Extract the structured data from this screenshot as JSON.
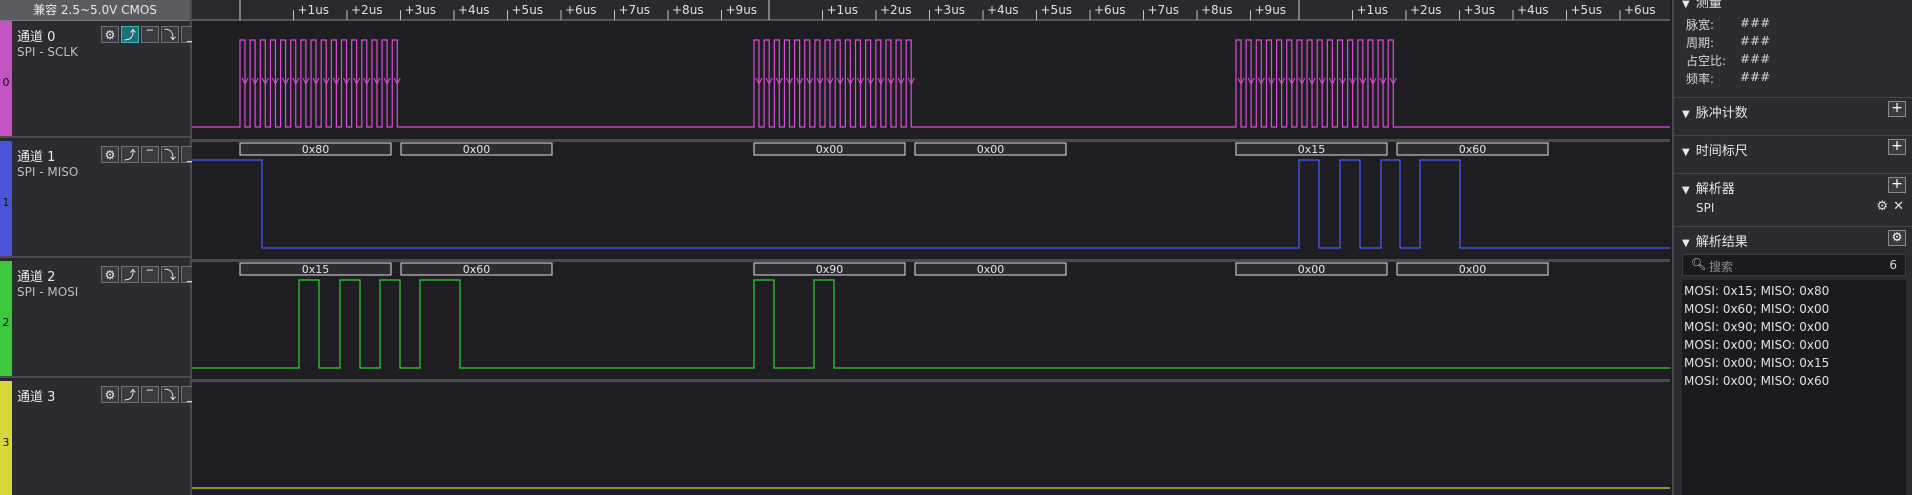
{
  "app": {
    "compat_label": "兼容 2.5~5.0V CMOS"
  },
  "channels": [
    {
      "index": "0",
      "title": "通道 0",
      "subtitle": "SPI - SCLK",
      "color": "#d64fd6",
      "strip": "#c454c4"
    },
    {
      "index": "1",
      "title": "通道 1",
      "subtitle": "SPI - MISO",
      "color": "#4a5cff",
      "strip": "#4a54d8"
    },
    {
      "index": "2",
      "title": "通道 2",
      "subtitle": "SPI - MOSI",
      "color": "#2fd32f",
      "strip": "#3cc83c"
    },
    {
      "index": "3",
      "title": "通道 3",
      "subtitle": "",
      "color": "#d6d62a",
      "strip": "#d8d83c"
    }
  ],
  "channel_buttons": {
    "gear": "⚙",
    "rise": "⤴",
    "high": "‾",
    "fall": "⤵",
    "low": "_"
  },
  "ruler": {
    "ticks": [
      "+1us",
      "+2us",
      "+3us",
      "+4us",
      "+5us",
      "+6us",
      "+7us",
      "+8us",
      "+9us",
      "+1us",
      "+2us",
      "+3us",
      "+4us",
      "+5us",
      "+6us",
      "+7us",
      "+8us",
      "+9us",
      "+1us",
      "+2us",
      "+3us",
      "+4us",
      "+5us",
      "+6us"
    ]
  },
  "decode": {
    "miso": [
      "0x80",
      "0x00",
      "0x00",
      "0x00",
      "0x15",
      "0x60"
    ],
    "mosi": [
      "0x15",
      "0x60",
      "0x90",
      "0x00",
      "0x00",
      "0x00"
    ]
  },
  "right_panel": {
    "measure": {
      "title": "测量",
      "rows": [
        {
          "label": "脉宽:",
          "value": "###"
        },
        {
          "label": "周期:",
          "value": "###"
        },
        {
          "label": "占空比:",
          "value": "###"
        },
        {
          "label": "频率:",
          "value": "###"
        }
      ]
    },
    "pulse_count": {
      "title": "脉冲计数"
    },
    "time_ruler": {
      "title": "时间标尺"
    },
    "analyzer": {
      "title": "解析器",
      "item": "SPI"
    },
    "results": {
      "title": "解析结果",
      "search_placeholder": "搜索",
      "count": "6",
      "rows": [
        "MOSI: 0x15;  MISO: 0x80",
        "MOSI: 0x60;  MISO: 0x00",
        "MOSI: 0x90;  MISO: 0x00",
        "MOSI: 0x00;  MISO: 0x00",
        "MOSI: 0x00;  MISO: 0x15",
        "MOSI: 0x00;  MISO: 0x60"
      ]
    }
  }
}
